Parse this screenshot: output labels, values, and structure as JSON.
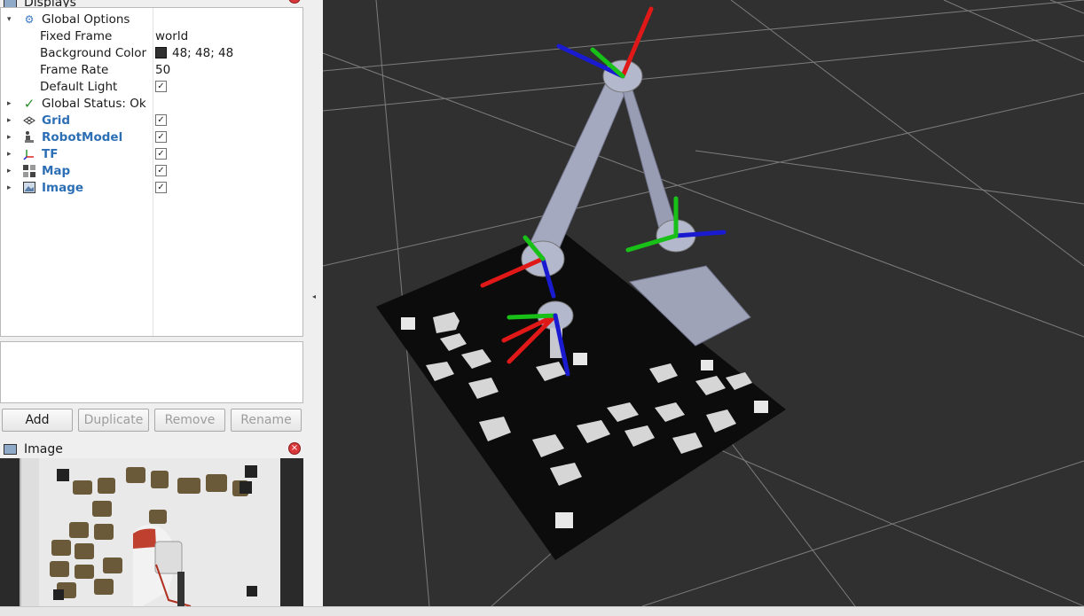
{
  "displays_panel": {
    "title": "Displays",
    "rows": [
      {
        "label": "Global Options"
      },
      {
        "label": "Fixed Frame",
        "value": "world"
      },
      {
        "label": "Background Color",
        "value": "48; 48; 48",
        "swatch_color": "#303030"
      },
      {
        "label": "Frame Rate",
        "value": "50"
      },
      {
        "label": "Default Light",
        "checked": "✓"
      },
      {
        "label": "Global Status: Ok"
      },
      {
        "label": "Grid",
        "checked": "✓"
      },
      {
        "label": "RobotModel",
        "checked": "✓"
      },
      {
        "label": "TF",
        "checked": "✓"
      },
      {
        "label": "Map",
        "checked": "✓"
      },
      {
        "label": "Image",
        "checked": "✓"
      }
    ],
    "buttons": {
      "add": "Add",
      "duplicate": "Duplicate",
      "remove": "Remove",
      "rename": "Rename"
    }
  },
  "image_panel": {
    "title": "Image"
  },
  "icons": {
    "close": "×",
    "expand": "▾",
    "collapse": "▸",
    "status_ok": "✓",
    "splitter": "◂"
  },
  "colors": {
    "viewport_bg": "#303030",
    "link_blue": "#2d6fb5",
    "status_green": "#2a8c2a",
    "close_red": "#d9383a"
  }
}
